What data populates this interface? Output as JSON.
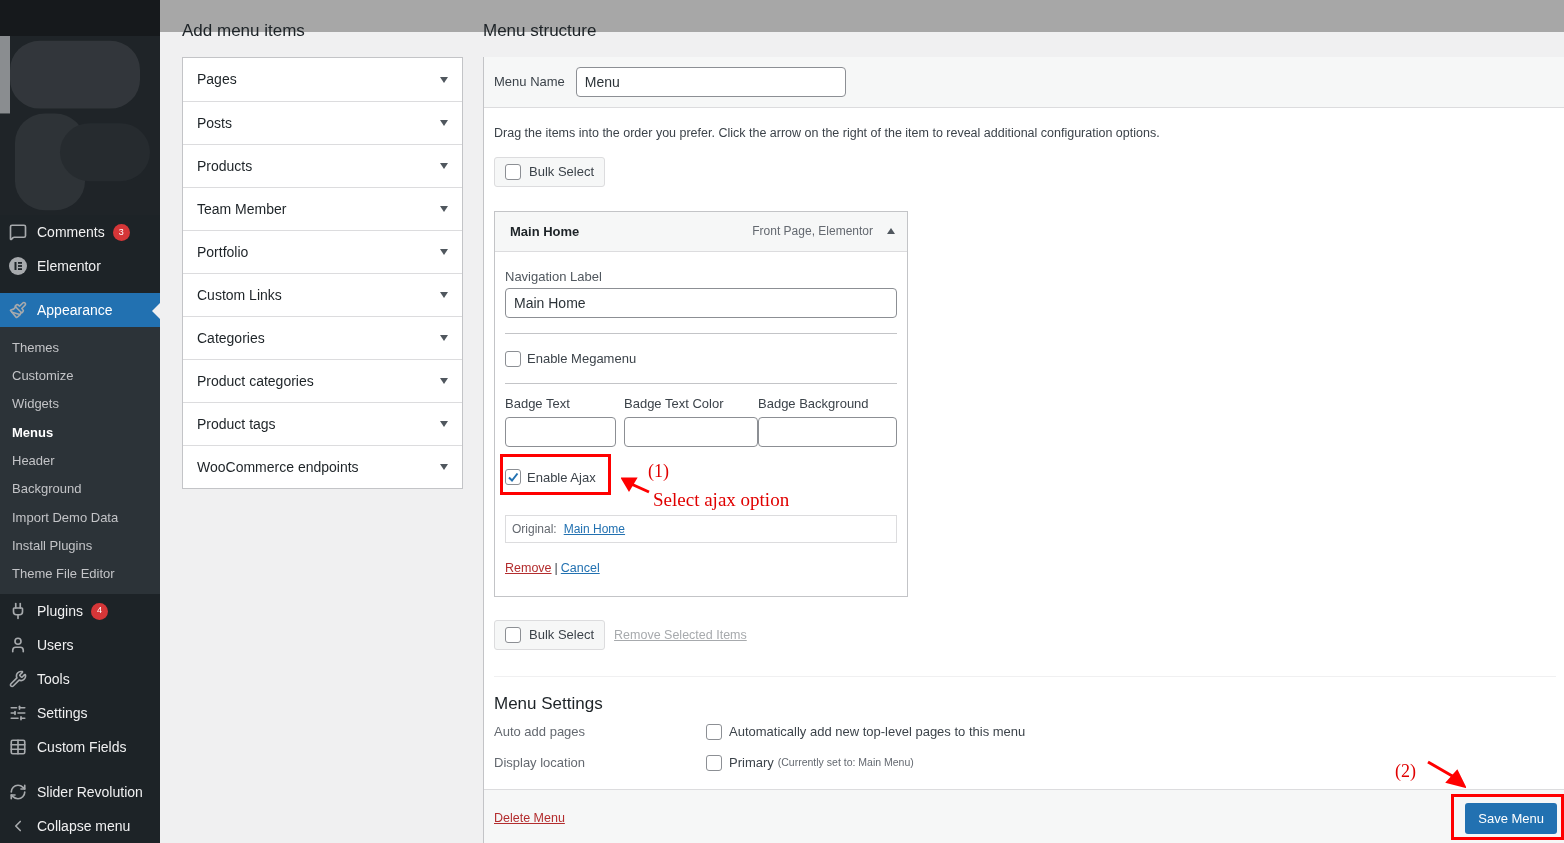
{
  "sidebar": {
    "items": [
      {
        "label": "Comments",
        "badge": "3",
        "selected": false
      },
      {
        "label": "Elementor",
        "selected": false
      },
      {
        "label": "Appearance",
        "selected": true,
        "children": [
          {
            "label": "Themes",
            "selected": false
          },
          {
            "label": "Customize",
            "selected": false
          },
          {
            "label": "Widgets",
            "selected": false
          },
          {
            "label": "Menus",
            "selected": true
          },
          {
            "label": "Header",
            "selected": false
          },
          {
            "label": "Background",
            "selected": false
          },
          {
            "label": "Import Demo Data",
            "selected": false
          },
          {
            "label": "Install Plugins",
            "selected": false
          },
          {
            "label": "Theme File Editor",
            "selected": false
          }
        ]
      },
      {
        "label": "Plugins",
        "badge": "4",
        "selected": false
      },
      {
        "label": "Users",
        "selected": false
      },
      {
        "label": "Tools",
        "selected": false
      },
      {
        "label": "Settings",
        "selected": false
      },
      {
        "label": "Custom Fields",
        "selected": false
      },
      {
        "label": "Slider Revolution",
        "selected": false
      },
      {
        "label": "Collapse menu",
        "selected": false
      }
    ]
  },
  "add_menu_items": {
    "title": "Add menu items",
    "sections": [
      {
        "label": "Pages",
        "expanded": false
      },
      {
        "label": "Posts",
        "expanded": false
      },
      {
        "label": "Products",
        "expanded": false
      },
      {
        "label": "Team Member",
        "expanded": false
      },
      {
        "label": "Portfolio",
        "expanded": false
      },
      {
        "label": "Custom Links",
        "expanded": false
      },
      {
        "label": "Categories",
        "expanded": false
      },
      {
        "label": "Product categories",
        "expanded": false
      },
      {
        "label": "Product tags",
        "expanded": false
      },
      {
        "label": "WooCommerce endpoints",
        "expanded": false
      }
    ]
  },
  "menu_structure": {
    "title": "Menu structure",
    "menu_name_label": "Menu Name",
    "menu_name_value": "Menu",
    "instructions": "Drag the items into the order you prefer. Click the arrow on the right of the item to reveal additional configuration options.",
    "bulk_select_top": {
      "label": "Bulk Select",
      "checked": false
    },
    "item": {
      "title": "Main Home",
      "meta": "Front Page, Elementor",
      "expanded": true,
      "nav_label": "Navigation Label",
      "nav_value": "Main Home",
      "megamenu": {
        "label": "Enable Megamenu",
        "checked": false
      },
      "badge_fields": [
        {
          "label": "Badge Text"
        },
        {
          "label": "Badge Text Color"
        },
        {
          "label": "Badge Background"
        }
      ],
      "ajax": {
        "label": "Enable Ajax",
        "checked": true
      },
      "original_label": "Original:",
      "original_link": "Main Home",
      "remove": "Remove",
      "separator": "|",
      "cancel": "Cancel"
    },
    "bulk_select_bottom": {
      "label": "Bulk Select",
      "checked": false
    },
    "remove_selected": "Remove Selected Items",
    "settings": {
      "title": "Menu Settings",
      "rows": [
        {
          "label": "Auto add pages",
          "option": "Automatically add new top-level pages to this menu",
          "checked": false
        },
        {
          "label": "Display location",
          "option": "Primary",
          "note": "(Currently set to: Main Menu)",
          "checked": false
        }
      ]
    },
    "delete": "Delete Menu",
    "save": "Save Menu"
  },
  "annotations": {
    "step1": "(1)",
    "step1_text": "Select ajax option",
    "step2": "(2)"
  }
}
